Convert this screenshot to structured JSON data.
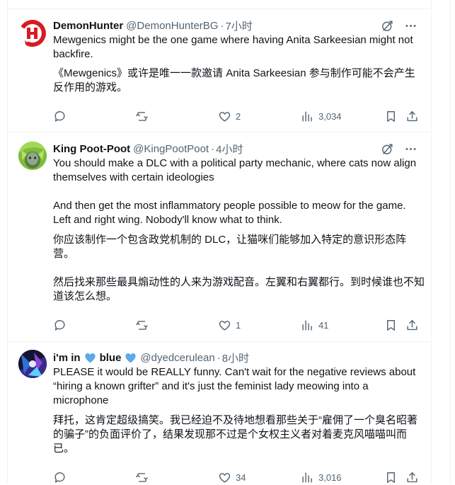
{
  "tweets": [
    {
      "display_name": "DemonHunter",
      "handle": "@DemonHunterBG",
      "separator": "·",
      "time": "7小时",
      "text_en": "Mewgenics might be the one game where having Anita Sarkeesian might not backfire.",
      "text_zh": "《Mewgenics》或许是唯一一款邀请 Anita Sarkeesian 参与制作可能不会产生反作用的游戏。",
      "replies": "",
      "reposts": "",
      "likes": "2",
      "views": "3,034"
    },
    {
      "display_name": "King Poot-Poot",
      "handle": "@KingPootPoot",
      "separator": "·",
      "time": "4小时",
      "text_en": "You should make a DLC with a political party mechanic, where cats now align themselves with certain ideologies\n\nAnd then get the most inflammatory people possible to meow for the game. Left and right wing. Nobody'll know what to think.",
      "text_zh": "你应该制作一个包含政党机制的 DLC，让猫咪们能够加入特定的意识形态阵营。\n\n然后找来那些最具煽动性的人来为游戏配音。左翼和右翼都行。到时候谁也不知道该怎么想。",
      "replies": "",
      "reposts": "",
      "likes": "1",
      "views": "41"
    },
    {
      "display_name_part1": "i'm in",
      "display_name_part2": "blue",
      "handle": "@dyedcerulean",
      "separator": "·",
      "time": "8小时",
      "text_en": "PLEASE it would be REALLY funny. Can't wait for the negative reviews about “hiring a known grifter” and it's just the feminist lady meowing into a microphone",
      "text_zh": "拜托，这肯定超级搞笑。我已经迫不及待地想看那些关于“雇佣了一个臭名昭著的骗子”的负面评价了，结果发现那不过是个女权主义者对着麦克风喵喵叫而已。",
      "replies": "",
      "reposts": "",
      "likes": "34",
      "views": "3,016"
    }
  ],
  "icons": {
    "grok": "grok-icon",
    "more": "more-icon",
    "reply": "reply-icon",
    "repost": "repost-icon",
    "like": "like-icon",
    "views": "views-icon",
    "bookmark": "bookmark-icon",
    "share": "share-icon"
  },
  "colors": {
    "text": "#0f1419",
    "secondary": "#536471",
    "divider": "#eff3f4",
    "blue_heart": "#5da9e9"
  }
}
